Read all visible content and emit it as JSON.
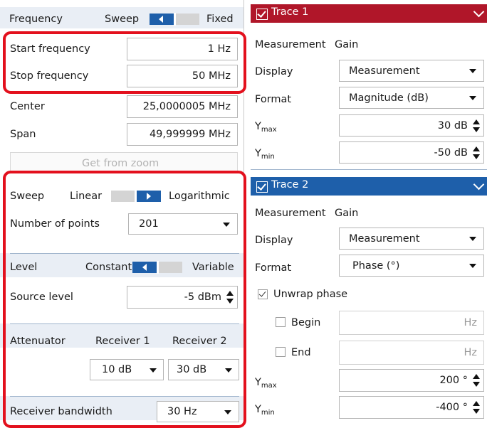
{
  "left": {
    "frequency": {
      "label": "Frequency",
      "left": "Sweep",
      "right": "Fixed"
    },
    "start": {
      "label": "Start frequency",
      "value": "1 Hz"
    },
    "stop": {
      "label": "Stop frequency",
      "value": "50 MHz"
    },
    "center": {
      "label": "Center",
      "value": "25,0000005 MHz"
    },
    "span": {
      "label": "Span",
      "value": "49,999999 MHz"
    },
    "zoom_button": "Get from zoom",
    "sweep": {
      "label": "Sweep",
      "left": "Linear",
      "right": "Logarithmic"
    },
    "points": {
      "label": "Number of points",
      "value": "201"
    },
    "level": {
      "label": "Level",
      "left": "Constant",
      "right": "Variable"
    },
    "source": {
      "label": "Source level",
      "value": "-5 dBm"
    },
    "attenuator": {
      "label": "Attenuator",
      "col1": "Receiver 1",
      "col2": "Receiver 2",
      "val1": "10 dB",
      "val2": "30 dB"
    },
    "rbw": {
      "label": "Receiver bandwidth",
      "value": "30 Hz"
    }
  },
  "trace1": {
    "title": "Trace 1",
    "color": "#b01629",
    "measurement_label": "Measurement",
    "measurement_value": "Gain",
    "display_label": "Display",
    "display_value": "Measurement",
    "format_label": "Format",
    "format_value": "Magnitude (dB)",
    "ymax_label": "Y",
    "ymax_sub": "max",
    "ymax_value": "30 dB",
    "ymin_label": "Y",
    "ymin_sub": "min",
    "ymin_value": "-50 dB"
  },
  "trace2": {
    "title": "Trace 2",
    "color": "#1e5faa",
    "measurement_label": "Measurement",
    "measurement_value": "Gain",
    "display_label": "Display",
    "display_value": "Measurement",
    "format_label": "Format",
    "format_value": "Phase (°)",
    "unwrap_label": "Unwrap phase",
    "begin_label": "Begin",
    "begin_unit": "Hz",
    "end_label": "End",
    "end_unit": "Hz",
    "ymax_label": "Y",
    "ymax_sub": "max",
    "ymax_value": "200 °",
    "ymin_label": "Y",
    "ymin_sub": "min",
    "ymin_value": "-400 °"
  }
}
